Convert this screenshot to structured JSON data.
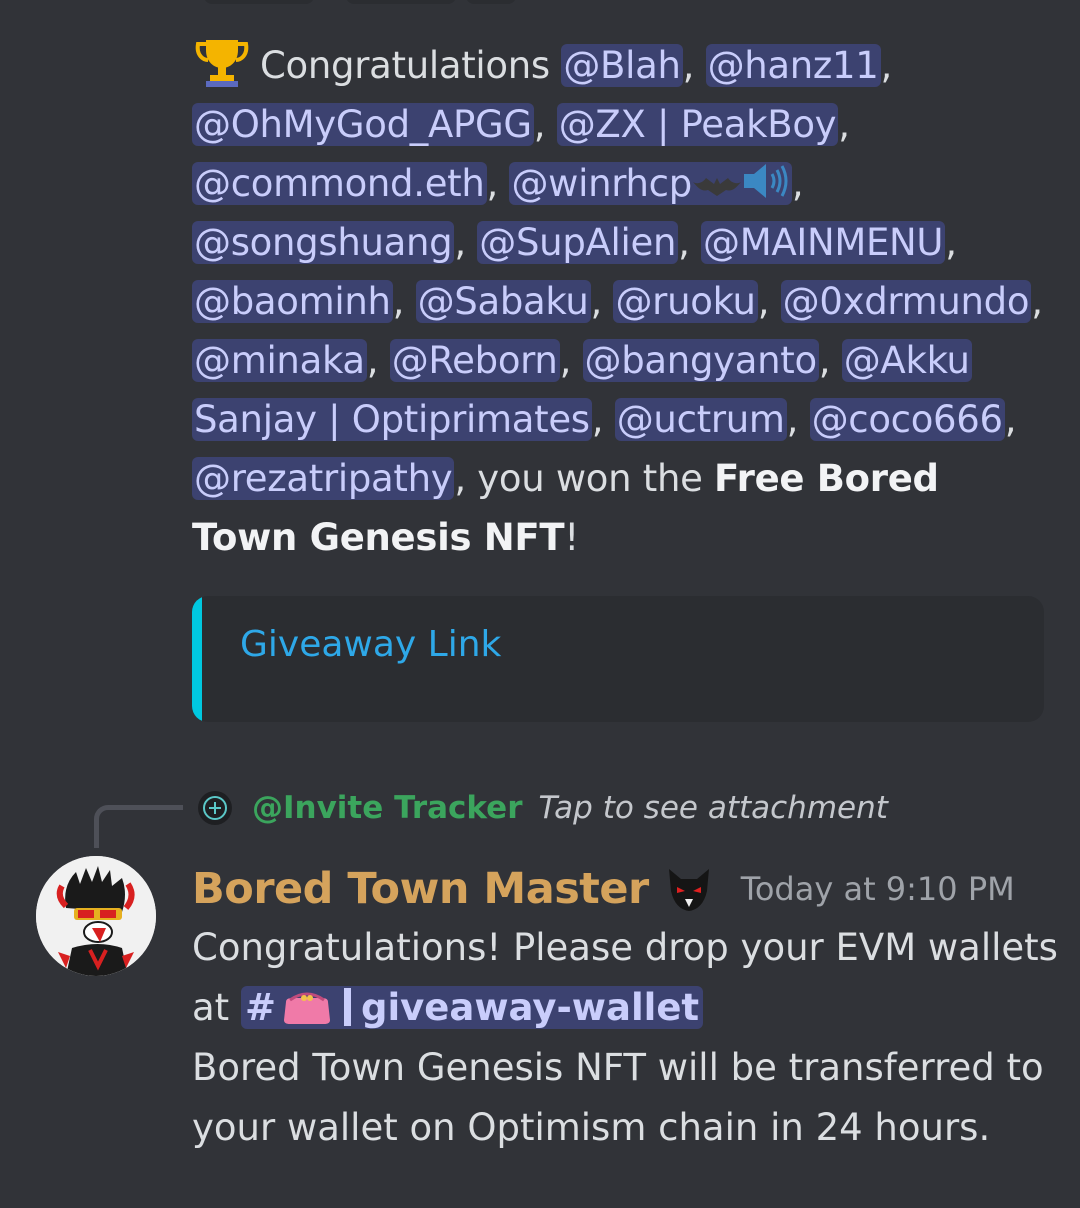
{
  "message1": {
    "trophy_icon": "trophy-icon",
    "congrats_text": "Congratulations ",
    "mentions": [
      "@Blah",
      "@hanz11",
      "@OhMyGod_APGG",
      "@ZX | PeakBoy",
      "@commond.eth",
      "@winrhcp",
      "@songshuang",
      "@SupAlien",
      "@MAINMENU",
      "@baominh",
      "@Sabaku",
      "@ruoku",
      "@0xdrmundo",
      "@minaka",
      "@Reborn",
      "@bangyanto",
      "@Akku Sanjay | Optiprimates",
      "@uctrum",
      "@coco666",
      "@rezatripathy"
    ],
    "separator": ", ",
    "mid_text": ", you won the ",
    "prize_text": "Free Bored Town Genesis NFT",
    "end_text": "!"
  },
  "embed": {
    "link_text": "Giveaway Link",
    "accent_color": "#00c8e0"
  },
  "reply": {
    "name": "@Invite Tracker",
    "text": "Tap to see attachment"
  },
  "message2": {
    "author": "Bored Town Master",
    "timestamp": "Today at 9:10 PM",
    "line1": "Congratulations! Please drop your EVM wallets",
    "at_text": "at ",
    "channel_hash": "#",
    "channel_name": "giveaway-wallet",
    "line3": "Bored Town Genesis NFT will be transferred to your wallet on Optimism chain in 24 hours."
  },
  "colors": {
    "background": "#313338",
    "mention_bg": "#3c4270",
    "mention_fg": "#c9cdfb",
    "author": "#d5a35c",
    "reply_name": "#3ba55d",
    "link": "#2ea8e8"
  }
}
